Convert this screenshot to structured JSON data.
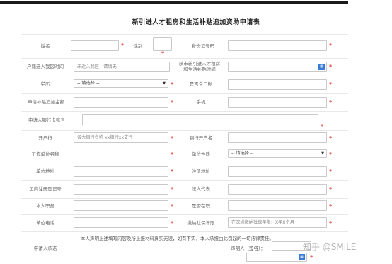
{
  "title": "新引进人才租房和生活补贴追加资助申请表",
  "fields": {
    "name_label": "姓名",
    "gender_label": "性别",
    "idcard_label": "身份证号码",
    "hukou_label": "户籍迁入我区时间",
    "hukou_placeholder": "未迁入我区，请填无",
    "subsidy_time_label": "获市新引进人才租房和生活补贴时间",
    "education_label": "学历",
    "education_value": "-- 请选择 --",
    "fulltime_label": "是否全日制",
    "amount_label": "申请补贴追加金额",
    "phone_label": "手机",
    "bank_card_label": "申请人银行卡账号",
    "bank_label": "开户行",
    "bank_placeholder": "各大银行名称 xx银行xx支行",
    "bank_account_name_label": "银行开户名",
    "employer_label": "工作单位名称",
    "employer_type_label": "单位性质",
    "employer_type_value": "-- 请选择 --",
    "address_label": "单位地址",
    "reg_address_label": "注册地址",
    "reg_no_label": "工商注册登记号",
    "legal_rep_label": "法人代表",
    "position_label": "本人职务",
    "in_office_label": "是否在职",
    "office_phone_label": "单位电话",
    "social_security_label": "缴纳社保年限",
    "social_security_placeholder": "在深圳缴纳社保年限：X年X个月",
    "commitment_label": "申请人承诺",
    "commitment_text": "本人声明上述填写内容及所上报材料真实无误，如有不实，本人承担由此引起的一切法律责任。",
    "signature_label": "声明人（签名）："
  },
  "icons": {
    "calendar": "calendar-icon",
    "dropdown": "chevron-down-icon"
  },
  "required_mark": "*",
  "watermark": "知乎 @SMiLE",
  "colors": {
    "required": "#e43b3b",
    "border": "#c9c9c9",
    "calendar": "#3b7bd6"
  }
}
